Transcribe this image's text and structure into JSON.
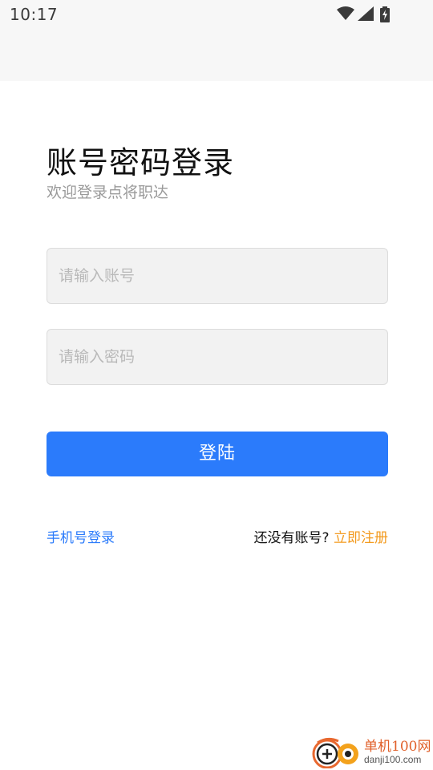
{
  "status_bar": {
    "time": "10:17",
    "icons": [
      "wifi-icon",
      "signal-icon",
      "battery-charging-icon"
    ]
  },
  "header": {
    "title": "账号密码登录",
    "subtitle": "欢迎登录点将职达"
  },
  "form": {
    "account_placeholder": "请输入账号",
    "account_value": "",
    "password_placeholder": "请输入密码",
    "password_value": "",
    "login_label": "登陆"
  },
  "footer": {
    "phone_login_label": "手机号登录",
    "no_account_text": "还没有账号?",
    "register_label": "立即注册"
  },
  "watermark": {
    "name": "单机100网",
    "url": "danji100.com"
  },
  "colors": {
    "primary": "#2b7bfb",
    "register_link": "#f39a1d",
    "input_bg": "#f2f2f2",
    "status_bar_bg": "#f7f7f7"
  }
}
